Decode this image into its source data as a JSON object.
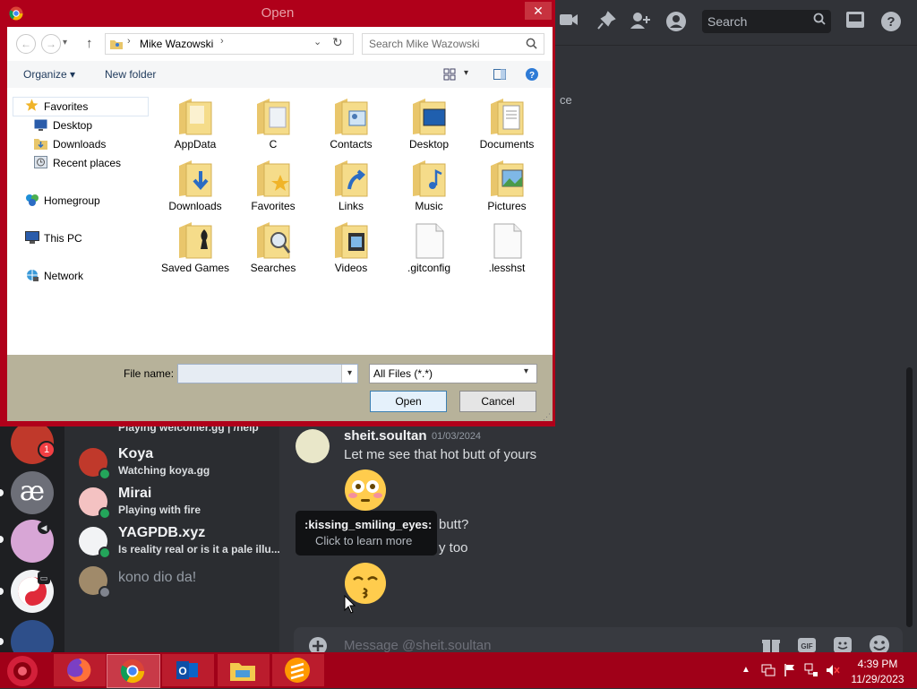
{
  "discord": {
    "search_placeholder": "Search",
    "topbar_icons": [
      "video-call-icon",
      "pin-icon",
      "add-friend-icon",
      "profile-icon",
      "inbox-icon",
      "help-icon"
    ],
    "fragment_text": "ce",
    "dms": [
      {
        "name": "",
        "sub": "Playing welcomer.gg | /help"
      },
      {
        "name": "Koya",
        "sub": "Watching koya.gg"
      },
      {
        "name": "Mirai",
        "sub": "Playing with fire"
      },
      {
        "name": "YAGPDB.xyz",
        "sub": "Is reality real or is it a pale illu..."
      },
      {
        "name": "kono dio da!",
        "sub": ""
      }
    ],
    "guild_badge": "1",
    "message": {
      "author": "sheit.soultan",
      "date": "01/03/2024",
      "line1": "Let me see that hot butt of yours",
      "line2_fragment": "butt?",
      "line3_fragment": "y too"
    },
    "tooltip": {
      "title": ":kissing_smiling_eyes:",
      "sub": "Click to learn more"
    },
    "message_placeholder": "Message @sheit.soultan",
    "composer_icons": [
      "add-icon",
      "gift-icon",
      "gif-icon",
      "sticker-icon",
      "emoji-icon"
    ]
  },
  "dialog": {
    "title": "Open",
    "close": "✕",
    "path": "Mike Wazowski",
    "search_placeholder": "Search Mike Wazowski",
    "organize": "Organize ▾",
    "new_folder": "New folder",
    "nav": {
      "favorites": "Favorites",
      "desktop": "Desktop",
      "downloads": "Downloads",
      "recent": "Recent places",
      "homegroup": "Homegroup",
      "thispc": "This PC",
      "network": "Network"
    },
    "files": [
      [
        "AppData",
        "C",
        "Contacts",
        "Desktop",
        "Documents"
      ],
      [
        "Downloads",
        "Favorites",
        "Links",
        "Music",
        "Pictures"
      ],
      [
        "Saved Games",
        "Searches",
        "Videos",
        ".gitconfig",
        ".lesshst"
      ]
    ],
    "file_name_label": "File name:",
    "file_name_value": "",
    "filter": "All Files (*.*)",
    "open": "Open",
    "cancel": "Cancel"
  },
  "taskbar": {
    "apps": [
      "firefox-icon",
      "chrome-icon",
      "outlook-icon",
      "file-explorer-icon",
      "sublime-merge-icon"
    ],
    "time": "4:39 PM",
    "date": "11/29/2023"
  },
  "colors": {
    "window_frame": "#b0001a",
    "taskbar": "#a00018",
    "discord_bg": "#313338",
    "dialog_bottom": "#b7b29a"
  }
}
